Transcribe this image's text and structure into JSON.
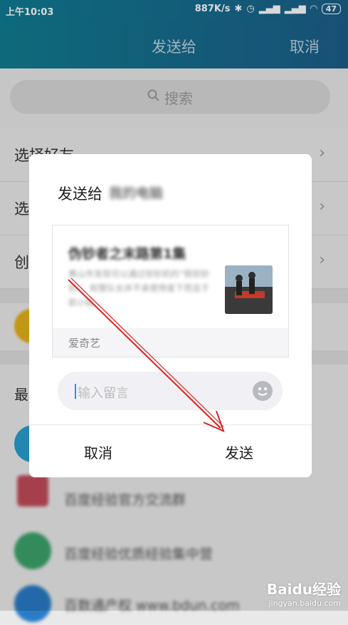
{
  "status_bar": {
    "time": "上午10:03",
    "speed": "887K/s",
    "battery": "47"
  },
  "header": {
    "title": "发送给",
    "cancel": "取消"
  },
  "search": {
    "label": "搜索"
  },
  "menu": [
    {
      "label": "选择好友"
    },
    {
      "label": "选"
    },
    {
      "label": "创"
    }
  ],
  "section_label": "最",
  "recent": [
    {
      "name": "百度经验官方交流群"
    },
    {
      "name": "百度经验优质经验集中营"
    },
    {
      "name": "百数通产权 www.bdun.com"
    }
  ],
  "dialog": {
    "title": "发送给",
    "recipient": "我的电脑",
    "card": {
      "title": "伪钞者之末路第1集",
      "description": "黄山市发现可以通过验钞机的“假验钞机”，和警队长并不来使用者下而且于前小组…",
      "source": "爱奇艺"
    },
    "message_placeholder": "输入留言",
    "cancel": "取消",
    "send": "发送"
  },
  "watermark": {
    "main": "Baidu经验",
    "sub": "jingyan.baidu.com"
  }
}
